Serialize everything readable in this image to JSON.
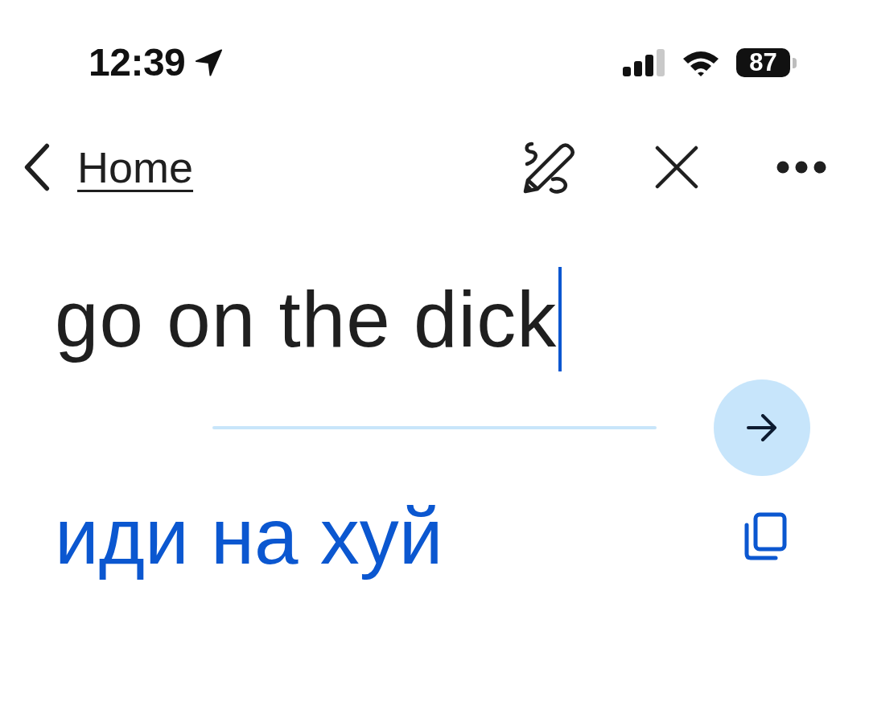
{
  "status_bar": {
    "time": "12:39",
    "battery": "87"
  },
  "nav_bar": {
    "back_label": "Home"
  },
  "source": {
    "value": "go on the dick"
  },
  "translation": {
    "text": "иди на хуй"
  }
}
